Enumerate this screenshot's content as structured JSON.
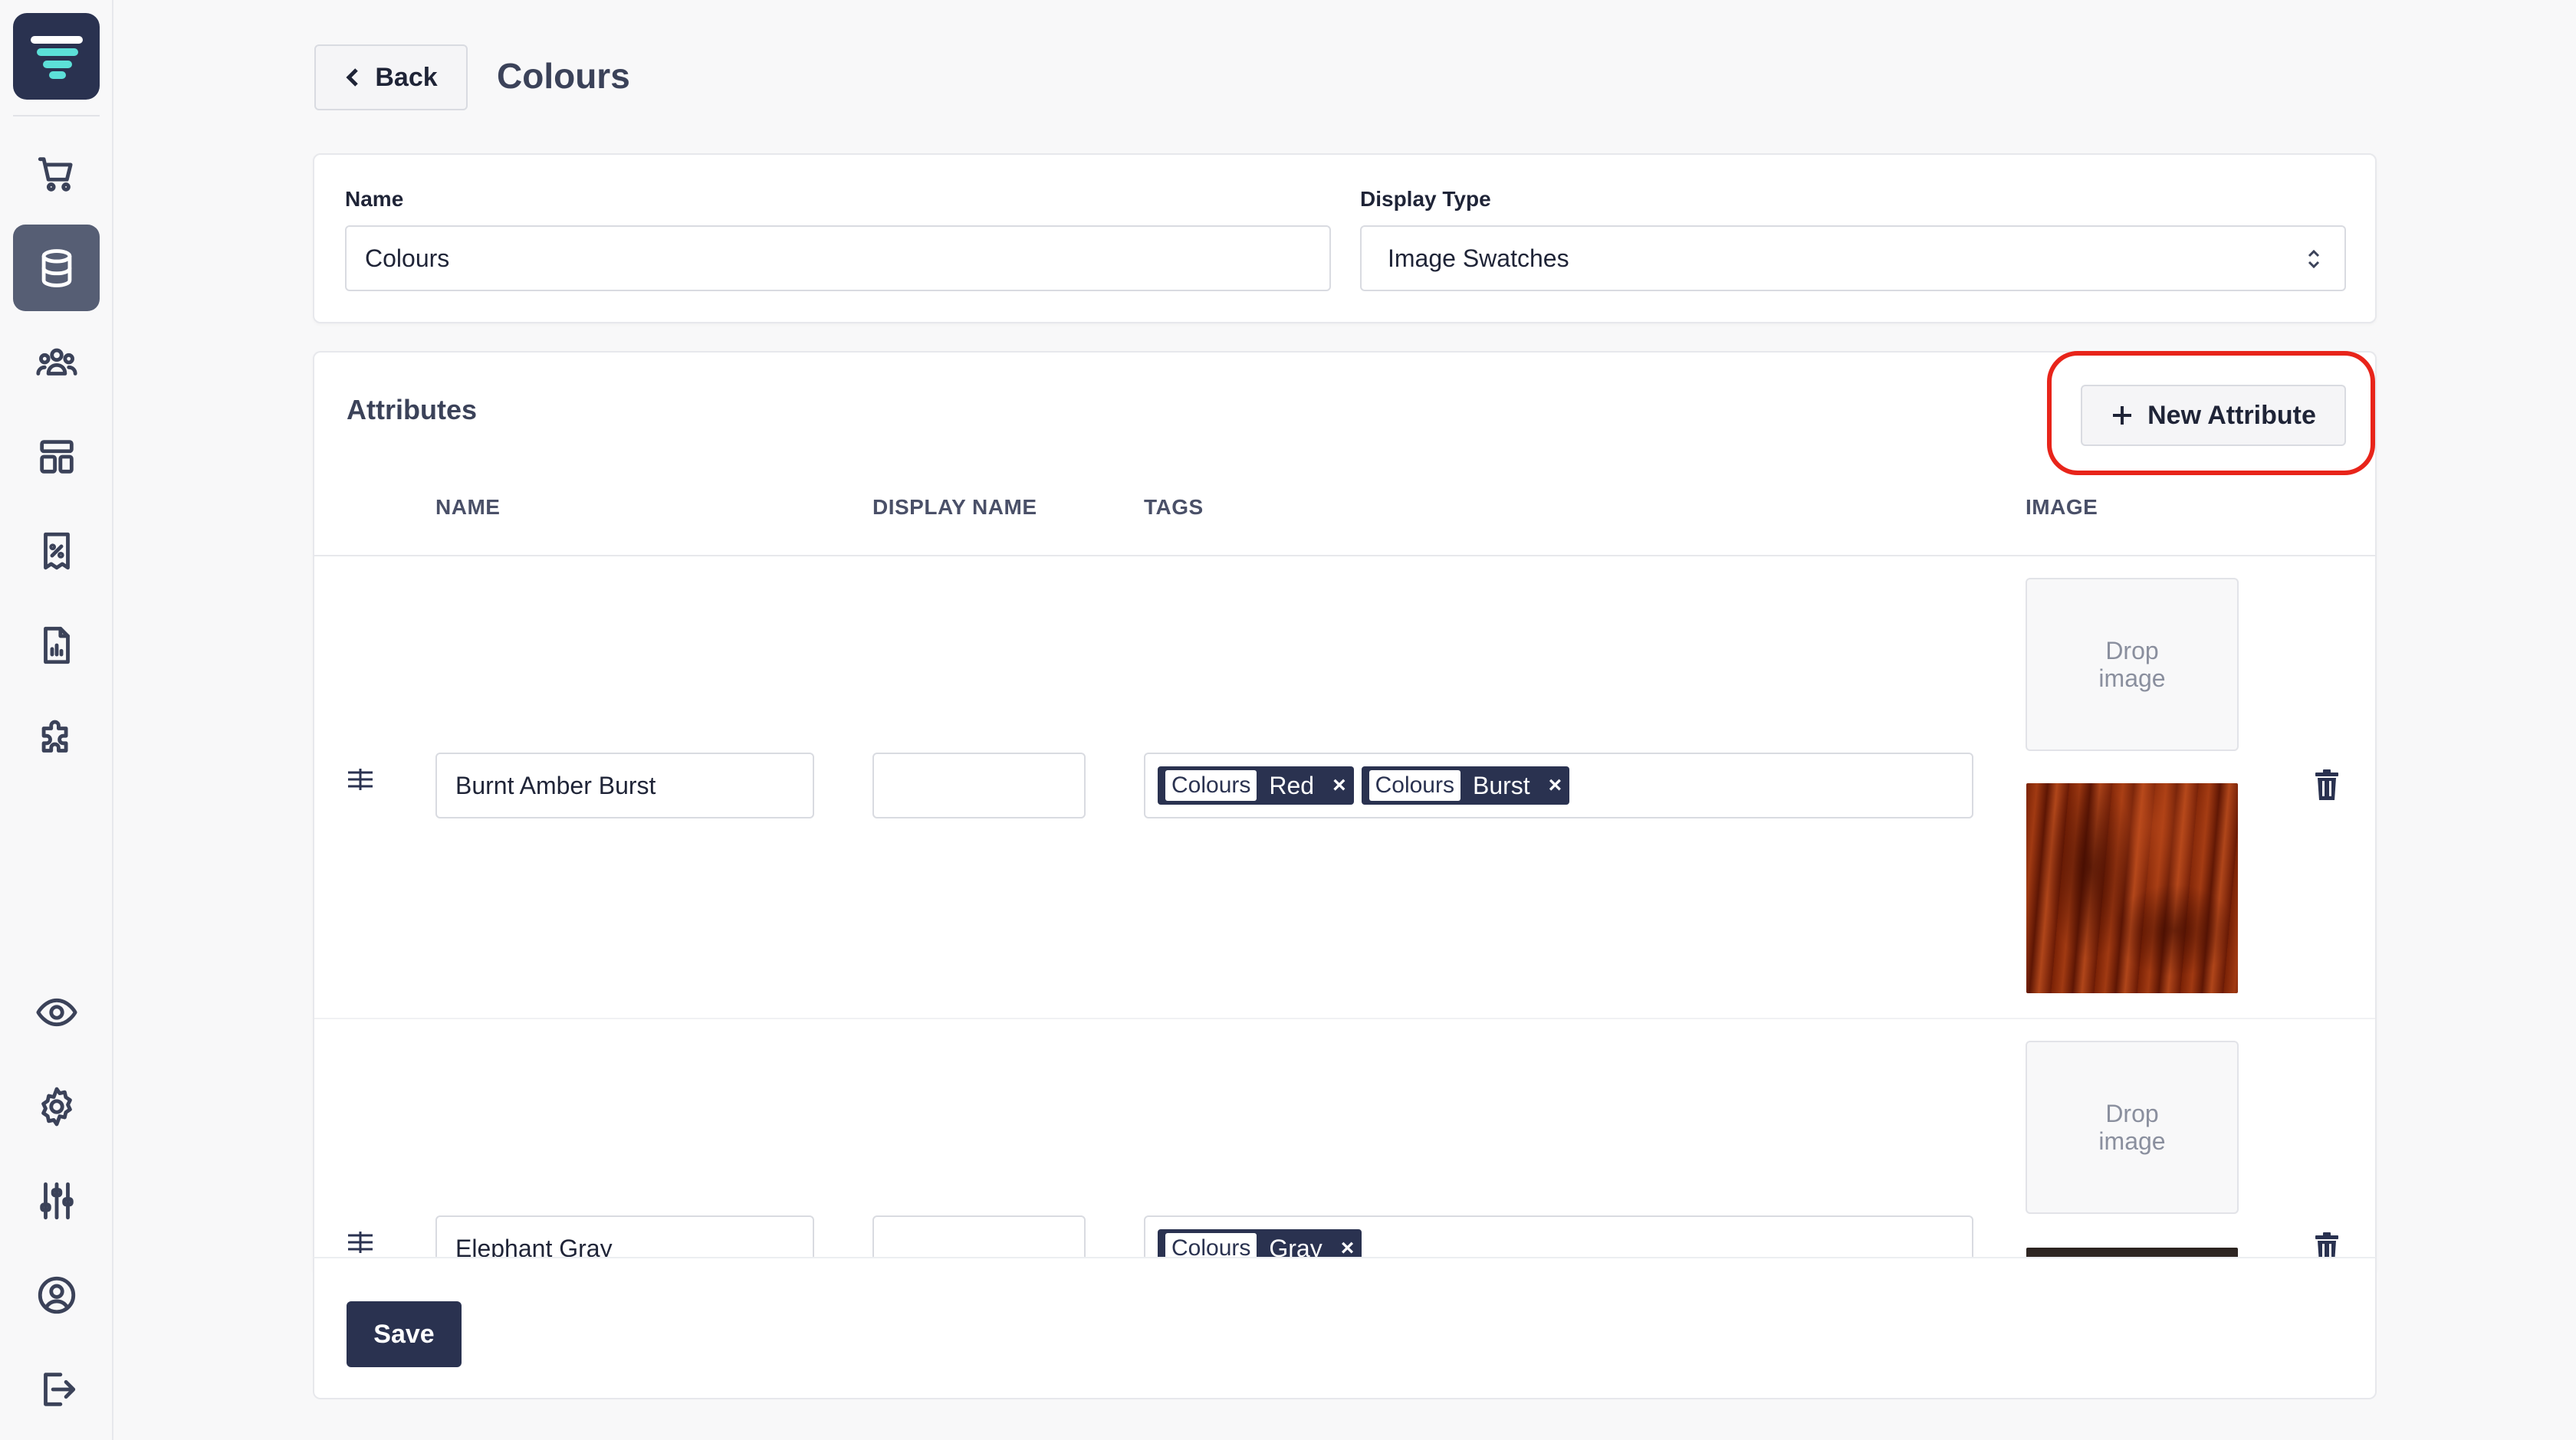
{
  "header": {
    "back_label": "Back",
    "title": "Colours"
  },
  "form": {
    "name_label": "Name",
    "name_value": "Colours",
    "display_type_label": "Display Type",
    "display_type_value": "Image Swatches"
  },
  "attributes": {
    "title": "Attributes",
    "new_button_label": "New Attribute",
    "columns": [
      "NAME",
      "DISPLAY NAME",
      "TAGS",
      "IMAGE"
    ],
    "drop_label": "Drop\nimage",
    "rows": [
      {
        "name": "Burnt Amber Burst",
        "display_name": "",
        "tags": [
          {
            "group": "Colours",
            "value": "Red"
          },
          {
            "group": "Colours",
            "value": "Burst"
          }
        ]
      },
      {
        "name": "Elephant Gray",
        "display_name": "",
        "tags": [
          {
            "group": "Colours",
            "value": "Gray"
          }
        ]
      }
    ]
  },
  "footer": {
    "save_label": "Save"
  },
  "colors": {
    "brand": "#2a3250",
    "highlight": "#e8241a",
    "logo_accent": "#5ce0d8"
  },
  "sidebar": {
    "top_items": [
      "cart-icon",
      "database-icon",
      "users-icon",
      "layout-icon",
      "receipt-percent-icon",
      "report-icon",
      "puzzle-icon"
    ],
    "bottom_items": [
      "eye-icon",
      "gear-icon",
      "sliders-icon",
      "user-circle-icon",
      "logout-icon"
    ],
    "active": "database-icon"
  }
}
